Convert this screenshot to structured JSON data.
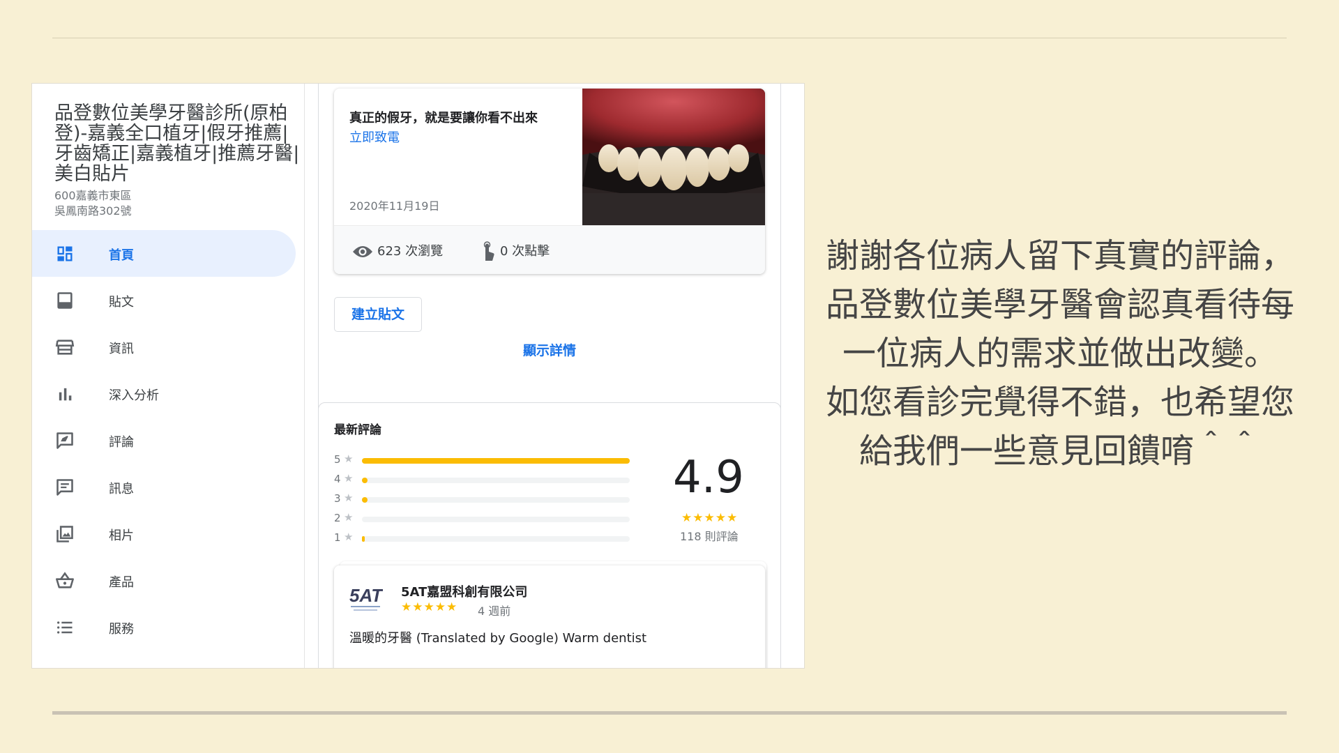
{
  "business": {
    "name": "品登數位美學牙醫診所(原柏登)-嘉義全口植牙|假牙推薦|牙齒矯正|嘉義植牙|推薦牙醫|美白貼片",
    "address_line1": "600嘉義市東區",
    "address_line2": "吳鳳南路302號"
  },
  "nav": [
    {
      "label": "首頁",
      "icon": "dashboard-icon",
      "active": true
    },
    {
      "label": "貼文",
      "icon": "posts-icon"
    },
    {
      "label": "資訊",
      "icon": "storefront-icon"
    },
    {
      "label": "深入分析",
      "icon": "bar-chart-icon"
    },
    {
      "label": "評論",
      "icon": "review-icon"
    },
    {
      "label": "訊息",
      "icon": "message-icon"
    },
    {
      "label": "相片",
      "icon": "photos-icon"
    },
    {
      "label": "產品",
      "icon": "basket-icon"
    },
    {
      "label": "服務",
      "icon": "list-icon"
    }
  ],
  "post": {
    "text": "真正的假牙，就是要讓你看不出來",
    "cta": "立即致電",
    "date": "2020年11月19日",
    "image": "teeth-photo",
    "views": "623 次瀏覽",
    "clicks": "0 次點擊",
    "create_button": "建立貼文",
    "details_link": "顯示詳情"
  },
  "reviews": {
    "title": "最新評論",
    "rating": "4.9",
    "stars_display": "★★★★★",
    "count": "118 則評論",
    "distribution": [
      {
        "stars": "5",
        "fraction": 1.0
      },
      {
        "stars": "4",
        "fraction": 0.02
      },
      {
        "stars": "3",
        "fraction": 0.02
      },
      {
        "stars": "2",
        "fraction": 0.0
      },
      {
        "stars": "1",
        "fraction": 0.008
      }
    ],
    "latest": {
      "reviewer": "5AT嘉盟科創有限公司",
      "logo_text": "5AT",
      "stars": "★★★★★",
      "time": "4 週前",
      "text": "溫暖的牙醫 (Translated by Google) Warm dentist"
    }
  },
  "message": {
    "lines": [
      "謝謝各位病人留下真實的評論，",
      "品登數位美學牙醫會認真看待每",
      "一位病人的需求並做出改變。",
      "如您看診完覺得不錯，也希望您",
      "給我們一些意見回饋唷＾＾"
    ]
  },
  "colors": {
    "background": "#f8f0d4",
    "accent_blue": "#1a73e8",
    "active_nav_bg": "#e8f0fe",
    "star_yellow": "#fbbc04",
    "message_text": "#454545"
  }
}
